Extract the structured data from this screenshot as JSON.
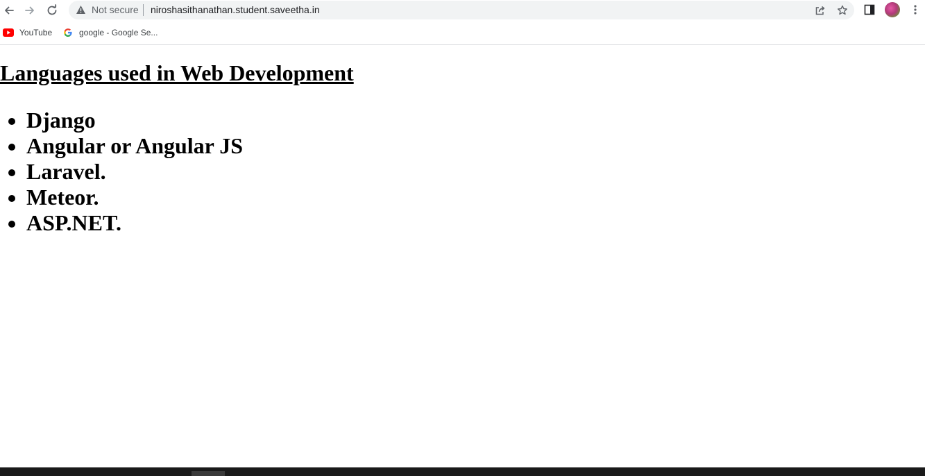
{
  "browser": {
    "security_label": "Not secure",
    "url": "niroshasithanathan.student.saveetha.in",
    "icons": {
      "back": "back-arrow-icon",
      "forward": "forward-arrow-icon",
      "reload": "reload-icon",
      "warning": "warning-triangle-icon",
      "share": "share-icon",
      "bookmark_star": "star-icon",
      "side_panel": "side-panel-icon",
      "profile": "avatar",
      "menu": "kebab-menu-icon"
    }
  },
  "bookmarks": [
    {
      "label": "YouTube",
      "icon": "youtube-icon"
    },
    {
      "label": "google - Google Se...",
      "icon": "google-icon"
    }
  ],
  "page": {
    "heading": "Languages used in Web Development",
    "languages": [
      "Django",
      "Angular or Angular JS",
      "Laravel.",
      "Meteor.",
      "ASP.NET."
    ]
  },
  "colors": {
    "toolbar_bg": "#ffffff",
    "omnibox_bg": "#f1f3f4",
    "icon_gray": "#5f6368",
    "youtube_red": "#ff0000"
  }
}
